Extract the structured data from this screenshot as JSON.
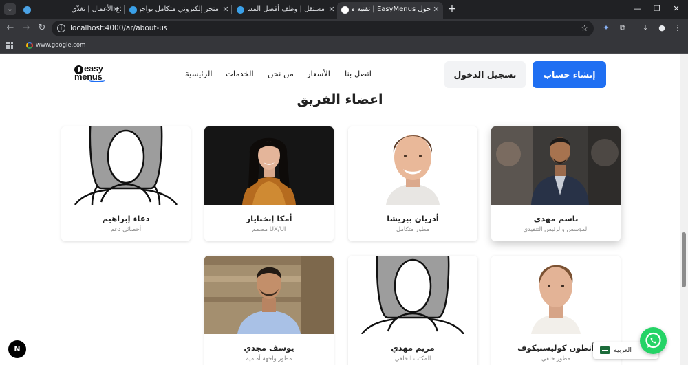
{
  "browser": {
    "tabs": [
      {
        "title": "تماذج الأعمال | تغذّي",
        "favicon_color": "#4ba3e6"
      },
      {
        "title": "متجر إلكتروني متكامل بواجهة حديثة",
        "favicon_color": "#3aa0e8"
      },
      {
        "title": "مستقل | وظف أفضل المستقلين",
        "favicon_color": "#3aa0e8"
      },
      {
        "title": "حول EasyMenus | تقنية مطاعم",
        "favicon_color": "#ffffff",
        "active": true
      }
    ],
    "url": "localhost:4000/ar/about-us",
    "bookmark": "www.google.com"
  },
  "header": {
    "logo_line1": "easy",
    "logo_line2": "menus",
    "nav": [
      "الرئيسية",
      "الخدمات",
      "من نحن",
      "الأسعار",
      "اتصل بنا"
    ],
    "login_label": "تسجيل الدخول",
    "signup_label": "إنشاء حساب"
  },
  "team": {
    "title": "اعضاء الفريق",
    "members": [
      {
        "name": "باسم مهدي",
        "role": "المؤسس والرئيس التنفيذي"
      },
      {
        "name": "أدريان بيريشا",
        "role": "مطور متكامل"
      },
      {
        "name": "أمكا إنخبايار",
        "role": "مصمم UX/UI"
      },
      {
        "name": "دعاء إبراهيم",
        "role": "أخصائي دعم"
      },
      {
        "name": "أنطون كوليسنيكوف",
        "role": "مطور خلفي"
      },
      {
        "name": "مريم مهدي",
        "role": "المكتب الخلفي"
      },
      {
        "name": "يوسف مجدي",
        "role": "مطور واجهة أمامية"
      }
    ]
  },
  "widgets": {
    "language_label": "العربية",
    "next_badge": "N"
  },
  "colors": {
    "primary": "#1f6ff2",
    "whatsapp": "#25d366"
  }
}
